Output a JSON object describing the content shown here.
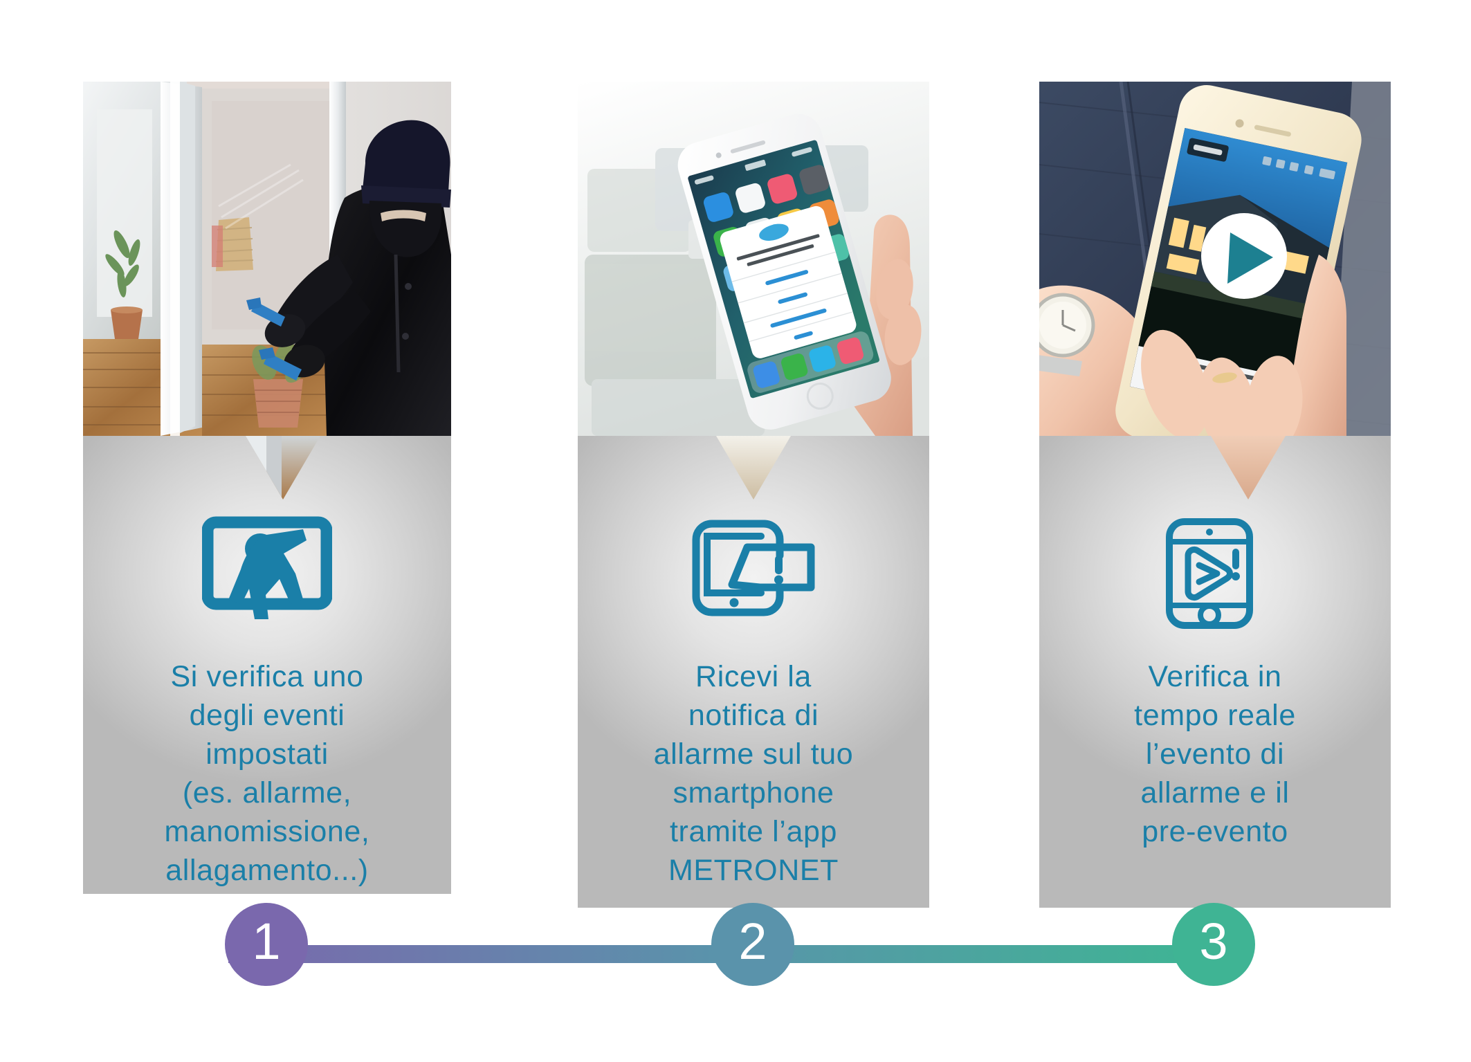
{
  "theme": {
    "accent_blue": "#1a7fa8",
    "step1_color": "#7a68ad",
    "step2_color": "#5a93ab",
    "step3_color": "#3fb494",
    "card_grey_light": "#f2f2f2",
    "card_grey_dark": "#b9b9b9",
    "background": "#ffffff"
  },
  "steps": [
    {
      "number": "1",
      "badge_color": "#7a68ad",
      "icon_name": "intruder-window-icon",
      "photo_name": "burglar-breaking-window-photo",
      "photo_alt": "Burglar in black clothing and balaclava prying open a patio door with a blue crowbar",
      "caption": "Si verifica uno\ndegli eventi\nimpostati\n(es. allarme,\nmanomissione,\nallagamento...)"
    },
    {
      "number": "2",
      "badge_color": "#5a93ab",
      "icon_name": "phone-alert-notification-icon",
      "photo_name": "hand-holding-smartphone-notification-photo",
      "photo_alt": "Hand holding a white smartphone showing an app notification dialog over the home screen",
      "caption": "Ricevi la\nnotifica di\nallarme sul tuo\nsmartphone\ntramite l’app\nMETRONET"
    },
    {
      "number": "3",
      "badge_color": "#3fb494",
      "icon_name": "phone-video-play-alert-icon",
      "photo_name": "hands-holding-smartphone-video-photo",
      "photo_alt": "Hands holding a gold smartphone playing live video of a house with a play button overlay",
      "caption": "Verifica in\ntempo reale\nl’evento di\nallarme e il\npre-evento"
    }
  ]
}
